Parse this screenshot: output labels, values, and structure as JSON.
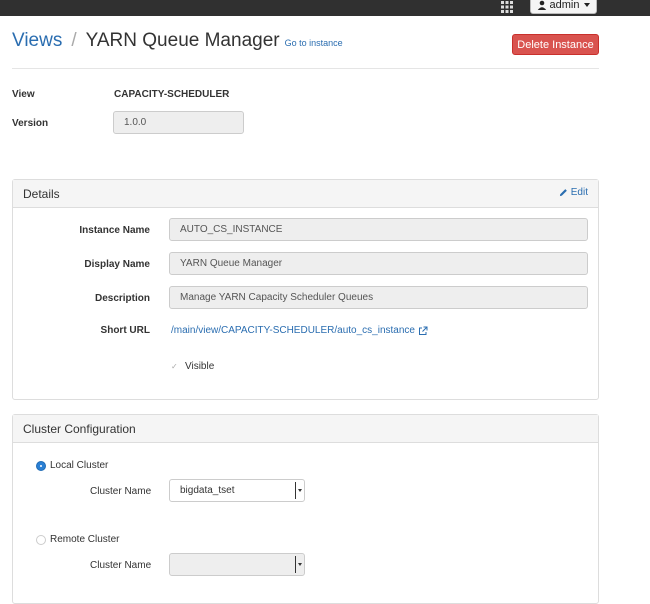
{
  "topbar": {
    "admin_label": "admin"
  },
  "header": {
    "views_label": "Views",
    "separator": "/",
    "title": "YARN Queue Manager",
    "goto_label": "Go to instance",
    "delete_label": "Delete Instance"
  },
  "meta": {
    "view_label": "View",
    "view_value": "CAPACITY-SCHEDULER",
    "version_label": "Version",
    "version_value": "1.0.0"
  },
  "details": {
    "title": "Details",
    "edit_label": "Edit",
    "instance_name_label": "Instance Name",
    "instance_name_value": "AUTO_CS_INSTANCE",
    "display_name_label": "Display Name",
    "display_name_value": "YARN Queue Manager",
    "description_label": "Description",
    "description_value": "Manage YARN Capacity Scheduler Queues",
    "short_url_label": "Short URL",
    "short_url_value": "/main/view/CAPACITY-SCHEDULER/auto_cs_instance",
    "visible_label": "Visible",
    "visible_checked": true
  },
  "cluster": {
    "title": "Cluster Configuration",
    "local_label": "Local Cluster",
    "local_selected": true,
    "local_cluster_name_label": "Cluster Name",
    "local_cluster_name_value": "bigdata_tset",
    "remote_label": "Remote Cluster",
    "remote_cluster_name_label": "Cluster Name",
    "remote_cluster_name_value": ""
  },
  "colors": {
    "link": "#2a6db0",
    "danger": "#d9534f",
    "topbar": "#303030",
    "radio_selected": "#2a7fd4"
  }
}
